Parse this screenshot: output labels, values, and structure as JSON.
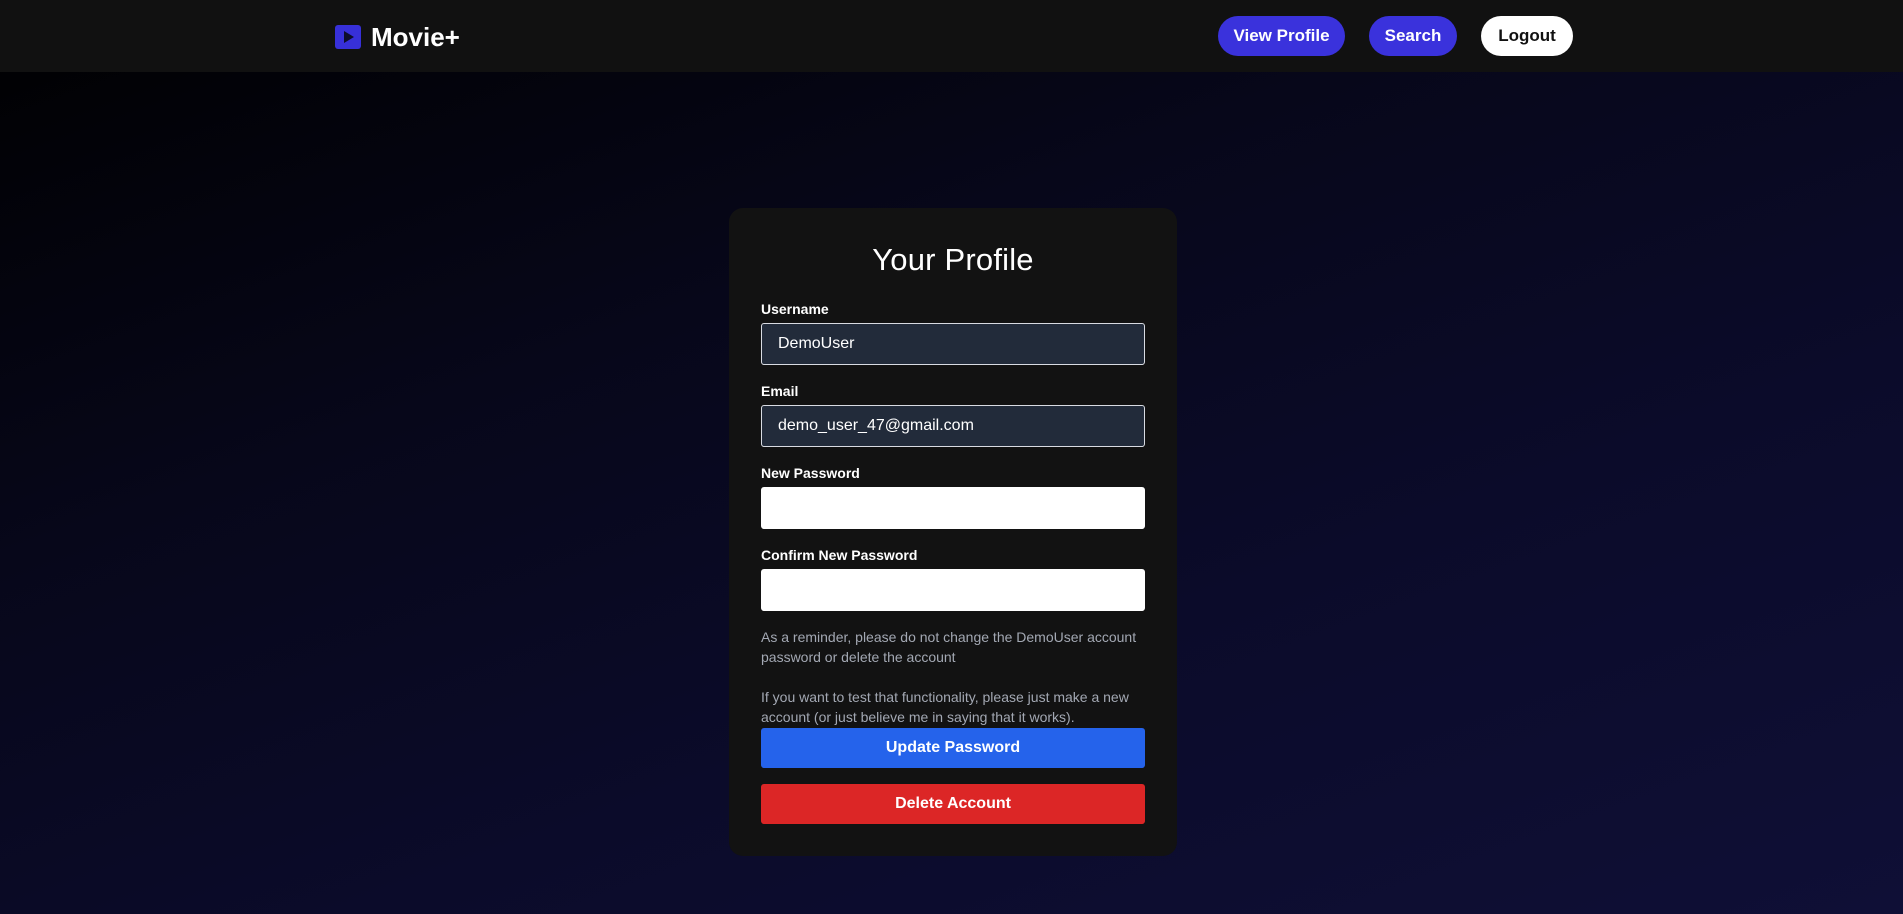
{
  "header": {
    "brand_name": "Movie+",
    "brand_icon": "play-icon",
    "nav": {
      "view_profile_label": "View Profile",
      "search_label": "Search",
      "logout_label": "Logout"
    }
  },
  "profile": {
    "title": "Your Profile",
    "username": {
      "label": "Username",
      "value": "DemoUser"
    },
    "email": {
      "label": "Email",
      "value": "demo_user_47@gmail.com"
    },
    "new_password": {
      "label": "New Password",
      "value": ""
    },
    "confirm_password": {
      "label": "Confirm New Password",
      "value": ""
    },
    "reminder_note": "As a reminder, please do not change the DemoUser account password or delete the account",
    "test_note": "If you want to test that functionality, please just make a new account (or just believe me in saying that it works).",
    "update_password_label": "Update Password",
    "delete_account_label": "Delete Account"
  },
  "colors": {
    "accent": "#3a32dc",
    "update_button": "#2563eb",
    "delete_button": "#dc2626",
    "card_background": "#121212",
    "navbar_background": "#111111"
  }
}
